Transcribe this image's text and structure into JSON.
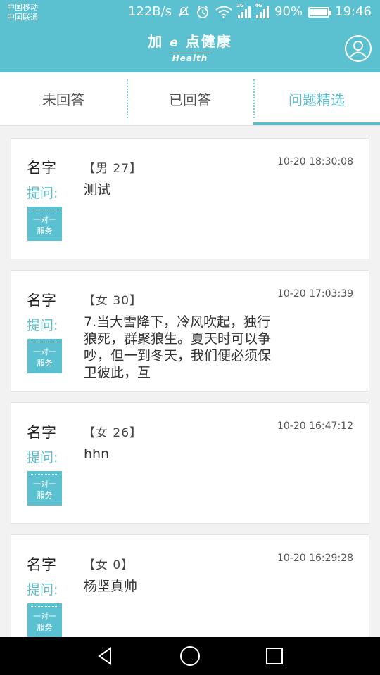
{
  "status_bar": {
    "carrier_1": "中国移动",
    "carrier_2": "中国联通",
    "speed": "122B/s",
    "net_2g": "2G",
    "net_4g": "4G",
    "battery": "90%",
    "time": "19:46",
    "icons": [
      "mute-icon",
      "alarm-icon",
      "wifi-icon",
      "signal-icon",
      "battery-icon"
    ]
  },
  "header": {
    "brand_left": "加",
    "brand_e": "e",
    "brand_right": "点健康",
    "brand_sub": "Health",
    "user_icon": "user-icon",
    "accent": "#5bc0d0"
  },
  "tabs": [
    {
      "label": "未回答",
      "active": false
    },
    {
      "label": "已回答",
      "active": false
    },
    {
      "label": "问题精选",
      "active": true
    }
  ],
  "items": [
    {
      "name": "名字",
      "meta": "【男 27】",
      "time": "10-20 18:30:08",
      "ask_label": "提问:",
      "question": "测试",
      "badge_line1": "一对一",
      "badge_line2": "服务"
    },
    {
      "name": "名字",
      "meta": "【女 30】",
      "time": "10-20 17:03:39",
      "ask_label": "提问:",
      "question": "7.当大雪降下，冷风吹起，独行狼死，群聚狼生。夏天时可以争吵，但一到冬天，我们便必须保卫彼此，互",
      "badge_line1": "一对一",
      "badge_line2": "服务"
    },
    {
      "name": "名字",
      "meta": "【女 26】",
      "time": "10-20 16:47:12",
      "ask_label": "提问:",
      "question": "hhn",
      "badge_line1": "一对一",
      "badge_line2": "服务"
    },
    {
      "name": "名字",
      "meta": "【女 0】",
      "time": "10-20 16:29:28",
      "ask_label": "提问:",
      "question": "杨坚真帅",
      "badge_line1": "一对一",
      "badge_line2": "服务"
    }
  ],
  "nav": {
    "back_icon": "back-triangle-icon",
    "home_icon": "home-circle-icon",
    "recent_icon": "recent-square-icon"
  }
}
